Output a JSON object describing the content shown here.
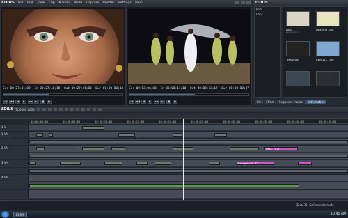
{
  "app": {
    "logo": "EDIUS",
    "menu": [
      "File",
      "Edit",
      "View",
      "Clip",
      "Marker",
      "Mode",
      "Capture",
      "Render",
      "Settings",
      "Help"
    ]
  },
  "player_left": {
    "cur": "Cur 00:27:41;02",
    "in": "In 00:27:40;18",
    "out": "Out 00:27:41;00",
    "dur": "Dur 00:00:00;13"
  },
  "player_right": {
    "cur": "Cur 00:03:06;08",
    "in": "In 00:00:11;10",
    "out": "Out 00:03:13;17",
    "dur": "Dur 00:00:02;07"
  },
  "transport_buttons": [
    "|◀",
    "◀◀",
    "◀",
    "▶",
    "▶▶",
    "▶|",
    "■",
    "●"
  ],
  "bin": {
    "title": "EDIUS",
    "tree": [
      "Root",
      "Clips"
    ],
    "clips": [
      {
        "name": "cool",
        "time": "00:00:01:17",
        "color": "#d9d4c4"
      },
      {
        "name": "Opening Title",
        "time": "",
        "color": "#e9e4c0"
      },
      {
        "name": "Transition",
        "time": "",
        "color": "#222"
      },
      {
        "name": "Card11C_000",
        "time": "",
        "color": "#7fa7cf"
      },
      {
        "name": "",
        "time": "",
        "color": "#3a4652"
      },
      {
        "name": "",
        "time": "",
        "color": "#2a2f36"
      }
    ],
    "tabs": [
      "Bin",
      "Effect",
      "Sequence marker",
      "Information"
    ],
    "active_tab": "Information"
  },
  "timeline": {
    "logo": "EDIUS",
    "sequence": "TL 0001 0000",
    "ruler": [
      "00:00:00;00",
      "00:00:05;00",
      "00:00:10;00",
      "00:00:15;00",
      "00:00:20;00",
      "00:00:25;00",
      "00:00:30;00",
      "00:00:35;00",
      "00:00:40;00",
      "00:00:45;00"
    ],
    "tracks": [
      "1 V",
      "1 VA",
      "2 VA",
      "",
      "3 VA",
      "",
      "4 VA",
      "",
      ""
    ],
    "clip_labels": [
      "tras - T1 (1)",
      "Background - T2"
    ]
  },
  "status": {
    "text": "[Dea-36] Sc Reminder/Act1"
  },
  "taskbar": {
    "task": "EDIUS",
    "clock": "10:41 AM"
  }
}
